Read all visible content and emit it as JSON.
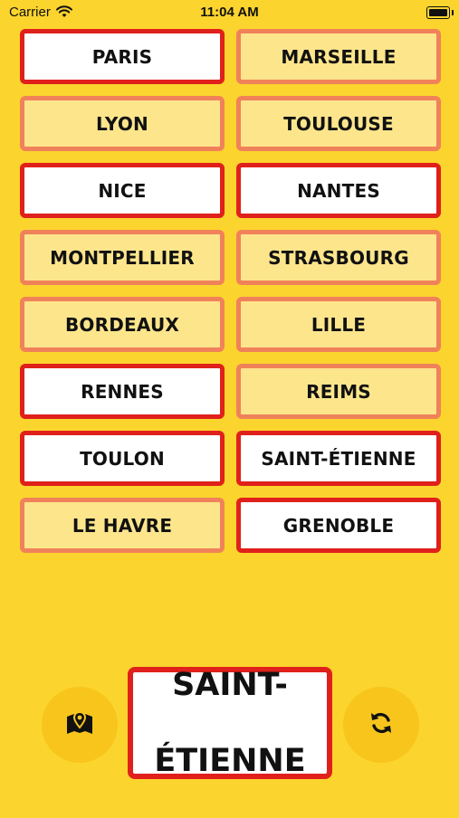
{
  "status_bar": {
    "carrier": "Carrier",
    "time": "11:04 AM"
  },
  "cities": [
    {
      "label": "PARIS",
      "style": "red"
    },
    {
      "label": "MARSEILLE",
      "style": "soft"
    },
    {
      "label": "LYON",
      "style": "soft"
    },
    {
      "label": "TOULOUSE",
      "style": "soft"
    },
    {
      "label": "NICE",
      "style": "red"
    },
    {
      "label": "NANTES",
      "style": "red"
    },
    {
      "label": "MONTPELLIER",
      "style": "soft"
    },
    {
      "label": "STRASBOURG",
      "style": "soft"
    },
    {
      "label": "BORDEAUX",
      "style": "soft"
    },
    {
      "label": "LILLE",
      "style": "soft"
    },
    {
      "label": "RENNES",
      "style": "red"
    },
    {
      "label": "REIMS",
      "style": "soft"
    },
    {
      "label": "TOULON",
      "style": "red"
    },
    {
      "label": "SAINT-ÉTIENNE",
      "style": "red"
    },
    {
      "label": "LE HAVRE",
      "style": "soft"
    },
    {
      "label": "GRENOBLE",
      "style": "red"
    }
  ],
  "target": {
    "line1": "SAINT-",
    "line2": "ÉTIENNE"
  },
  "controls": {
    "map_icon": "map-marker-icon",
    "refresh_icon": "refresh-icon"
  },
  "colors": {
    "background": "#FCD42E",
    "sign_red": "#E0201B",
    "sign_soft_border": "#F0825A",
    "sign_soft_fill": "#FDE58C",
    "button": "#F7C51C"
  }
}
